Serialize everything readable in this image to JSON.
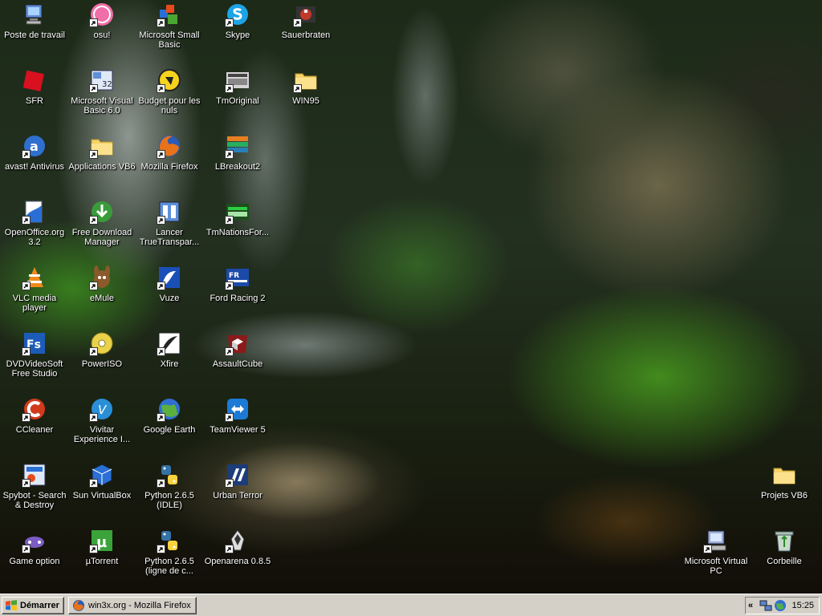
{
  "desktop": {
    "icons": [
      {
        "id": "poste",
        "label": "Poste de travail",
        "icon": "computer-icon",
        "shortcut": false
      },
      {
        "id": "osu",
        "label": "osu!",
        "icon": "osu-icon",
        "shortcut": true
      },
      {
        "id": "smallbasic",
        "label": "Microsoft Small Basic",
        "icon": "small-basic-icon",
        "shortcut": true
      },
      {
        "id": "skype",
        "label": "Skype",
        "icon": "skype-icon",
        "shortcut": true
      },
      {
        "id": "sauerbraten",
        "label": "Sauerbraten",
        "icon": "sauerbraten-icon",
        "shortcut": true
      },
      {
        "id": "sfr",
        "label": "SFR",
        "icon": "sfr-icon",
        "shortcut": false
      },
      {
        "id": "vb6",
        "label": "Microsoft Visual Basic 6.0",
        "icon": "visual-basic-icon",
        "shortcut": true
      },
      {
        "id": "budget",
        "label": "Budget pour les nuls",
        "icon": "budget-icon",
        "shortcut": true
      },
      {
        "id": "tmoriginal",
        "label": "TmOriginal",
        "icon": "tmoriginal-icon",
        "shortcut": true
      },
      {
        "id": "win95",
        "label": "WIN95",
        "icon": "folder-icon",
        "shortcut": true
      },
      {
        "id": "avast",
        "label": "avast! Antivirus",
        "icon": "avast-icon",
        "shortcut": true
      },
      {
        "id": "appsvb6",
        "label": "Applications VB6",
        "icon": "folder-icon",
        "shortcut": true
      },
      {
        "id": "firefox",
        "label": "Mozilla Firefox",
        "icon": "firefox-icon",
        "shortcut": true
      },
      {
        "id": "lbreakout",
        "label": "LBreakout2",
        "icon": "lbreakout-icon",
        "shortcut": true
      },
      {
        "id": "openoffice",
        "label": "OpenOffice.org 3.2",
        "icon": "openoffice-icon",
        "shortcut": true
      },
      {
        "id": "fdm",
        "label": "Free Download Manager",
        "icon": "download-manager-icon",
        "shortcut": true
      },
      {
        "id": "truetransparency",
        "label": "Lancer TrueTranspar...",
        "icon": "truetransparency-icon",
        "shortcut": true
      },
      {
        "id": "tmnations",
        "label": "TmNationsFor...",
        "icon": "tmnations-icon",
        "shortcut": true
      },
      {
        "id": "vlc",
        "label": "VLC media player",
        "icon": "vlc-icon",
        "shortcut": true
      },
      {
        "id": "emule",
        "label": "eMule",
        "icon": "emule-icon",
        "shortcut": true
      },
      {
        "id": "vuze",
        "label": "Vuze",
        "icon": "vuze-icon",
        "shortcut": true
      },
      {
        "id": "fordracing",
        "label": "Ford Racing 2",
        "icon": "ford-racing-icon",
        "shortcut": true
      },
      {
        "id": "dvdvideosoft",
        "label": "DVDVideoSoft Free Studio",
        "icon": "dvdvideosoft-icon",
        "shortcut": true
      },
      {
        "id": "poweriso",
        "label": "PowerISO",
        "icon": "poweriso-icon",
        "shortcut": true
      },
      {
        "id": "xfire",
        "label": "Xfire",
        "icon": "xfire-icon",
        "shortcut": true
      },
      {
        "id": "assaultcube",
        "label": "AssaultCube",
        "icon": "assaultcube-icon",
        "shortcut": true
      },
      {
        "id": "ccleaner",
        "label": "CCleaner",
        "icon": "ccleaner-icon",
        "shortcut": true
      },
      {
        "id": "vivitar",
        "label": "Vivitar Experience I...",
        "icon": "vivitar-icon",
        "shortcut": true
      },
      {
        "id": "googleearth",
        "label": "Google Earth",
        "icon": "google-earth-icon",
        "shortcut": true
      },
      {
        "id": "teamviewer",
        "label": "TeamViewer 5",
        "icon": "teamviewer-icon",
        "shortcut": true
      },
      {
        "id": "spybot",
        "label": "Spybot - Search & Destroy",
        "icon": "spybot-icon",
        "shortcut": true
      },
      {
        "id": "virtualbox",
        "label": "Sun VirtualBox",
        "icon": "virtualbox-icon",
        "shortcut": true
      },
      {
        "id": "pythonidle",
        "label": "Python 2.6.5 (IDLE)",
        "icon": "python-icon",
        "shortcut": true
      },
      {
        "id": "urbanterror",
        "label": "Urban Terror",
        "icon": "urban-terror-icon",
        "shortcut": true
      },
      {
        "id": "gameoption",
        "label": "Game option",
        "icon": "game-option-icon",
        "shortcut": true
      },
      {
        "id": "utorrent",
        "label": "µTorrent",
        "icon": "utorrent-icon",
        "shortcut": true
      },
      {
        "id": "pythoncmd",
        "label": "Python 2.6.5 (ligne de c...",
        "icon": "python-icon",
        "shortcut": true
      },
      {
        "id": "openarena",
        "label": "Openarena 0.8.5",
        "icon": "openarena-icon",
        "shortcut": true
      },
      {
        "id": "projetsvb6",
        "label": "Projets VB6",
        "icon": "folder-icon",
        "shortcut": false
      },
      {
        "id": "virtualpc",
        "label": "Microsoft Virtual PC",
        "icon": "virtual-pc-icon",
        "shortcut": true
      },
      {
        "id": "corbeille",
        "label": "Corbeille",
        "icon": "recycle-bin-icon",
        "shortcut": false
      }
    ]
  },
  "taskbar": {
    "start_label": "Démarrer",
    "task_label": "win3x.org - Mozilla Firefox",
    "tray_chevron": "«",
    "clock": "15:25"
  }
}
